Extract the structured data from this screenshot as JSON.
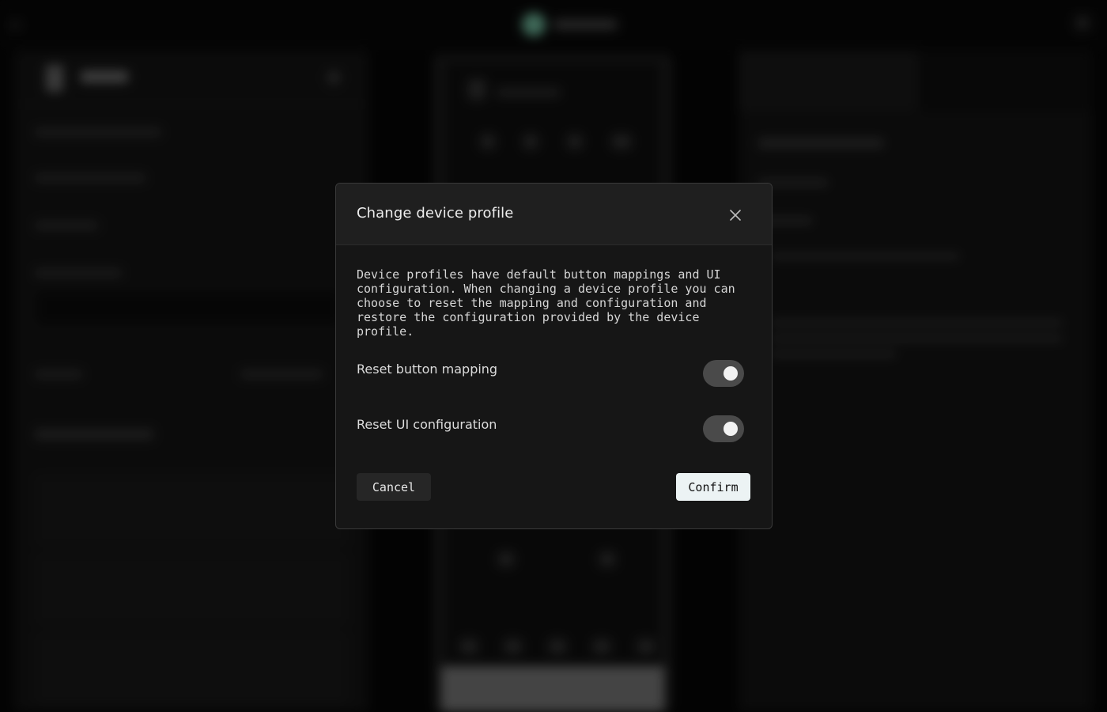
{
  "modal": {
    "title": "Change device profile",
    "description": "Device profiles have default button mappings and UI configuration. When changing a device profile you can choose to reset the mapping and configuration and restore the configuration provided by the device profile.",
    "options": [
      {
        "label": "Reset button mapping",
        "enabled": true
      },
      {
        "label": "Reset UI configuration",
        "enabled": true
      }
    ],
    "cancel_label": "Cancel",
    "confirm_label": "Confirm"
  },
  "icons": {
    "close": "close-icon"
  },
  "colors": {
    "overlay": "#000000",
    "modal_bg": "#161616",
    "modal_header_bg": "#1f1f1f",
    "confirm_bg": "#ecf3f4",
    "toggle_track": "#4a4a4a",
    "accent": "#7fd3b2"
  }
}
